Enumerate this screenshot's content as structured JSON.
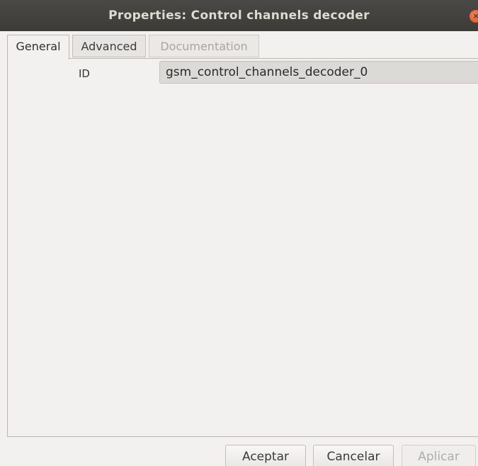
{
  "window": {
    "title": "Properties: Control channels decoder",
    "close_icon": "close-icon",
    "close_glyph": "×"
  },
  "tabs": [
    {
      "label": "General",
      "state": "active"
    },
    {
      "label": "Advanced",
      "state": "normal"
    },
    {
      "label": "Documentation",
      "state": "disabled"
    }
  ],
  "params": {
    "id_label": "ID",
    "id_value": "gsm_control_channels_decoder_0"
  },
  "buttons": {
    "accept": "Aceptar",
    "cancel": "Cancelar",
    "apply": "Aplicar"
  },
  "colors": {
    "titlebar": "#3c3b37",
    "close_button": "#df4a16",
    "window_bg": "#f2f1f0"
  }
}
